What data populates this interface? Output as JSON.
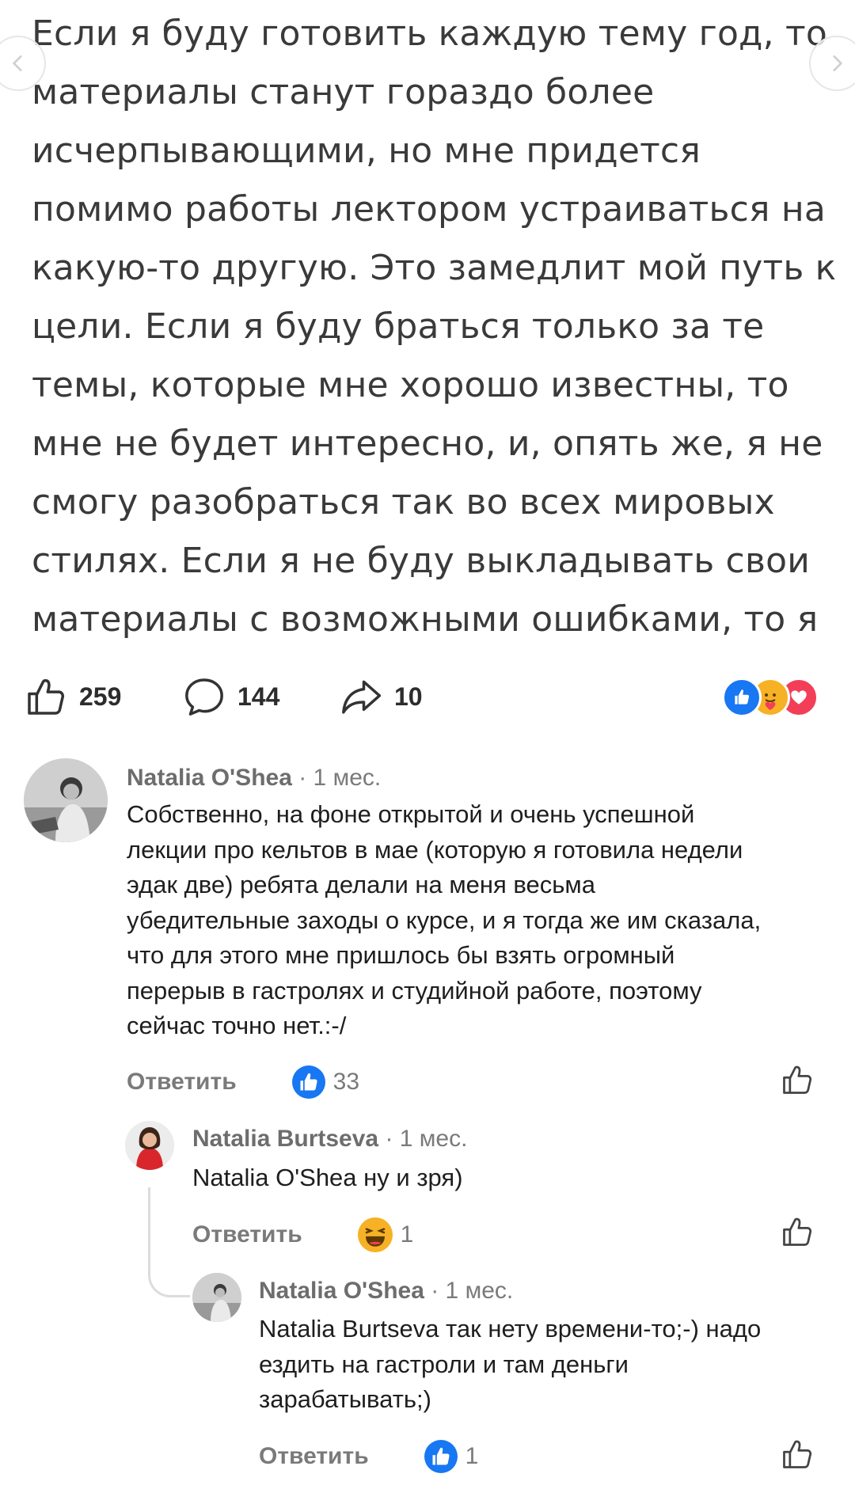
{
  "post": {
    "image_text_lines": [
      "Если я буду готовить каждую тему год, то",
      "материалы станут гораздо более",
      "исчерпывающими, но мне придется",
      "помимо работы лектором устраиваться на",
      "какую-то другую. Это замедлит мой путь к",
      "цели. Если я буду браться только за те",
      "темы, которые мне хорошо известны, то",
      "мне не будет интересно, и, опять же, я не",
      "смогу разобраться так во всех мировых",
      "стилях. Если я не буду выкладывать свои",
      "материалы с возможными ошибками, то я"
    ],
    "likes_count": "259",
    "comments_count": "144",
    "shares_count": "10",
    "reaction_icons": [
      "like-icon",
      "care-icon",
      "love-icon"
    ],
    "colors": {
      "like_blue": "#1877f2",
      "love_red": "#f33e58",
      "care_yellow": "#f7b125"
    }
  },
  "comments": [
    {
      "author": "Natalia O'Shea",
      "time": "· 1 мес.",
      "body_lines": [
        "Собственно, на фоне открытой и очень успешной",
        "лекции про кельтов в мае (которую я готовила недели",
        "эдак две) ребята делали на меня весьма",
        "убедительные заходы о курсе, и я тогда же им сказала,",
        "что для этого мне пришлось бы взять огромный",
        "перерыв в гастролях и студийной работе, поэтому",
        "сейчас точно нет.:-/"
      ],
      "reply_label": "Ответить",
      "reaction_icon": "like-icon",
      "reaction_count": "33"
    },
    {
      "author": "Natalia Burtseva",
      "time": "· 1 мес.",
      "body_lines": [
        "Natalia O'Shea ну и зря)"
      ],
      "reply_label": "Ответить",
      "reaction_icon": "haha-icon",
      "reaction_count": "1"
    },
    {
      "author": "Natalia O'Shea",
      "time": "· 1 мес.",
      "body_lines": [
        "Natalia Burtseva так нету времени-то;-) надо",
        "ездить на гастроли и там деньги",
        "зарабатывать;)"
      ],
      "reply_label": "Ответить",
      "reaction_icon": "like-icon",
      "reaction_count": "1"
    }
  ]
}
